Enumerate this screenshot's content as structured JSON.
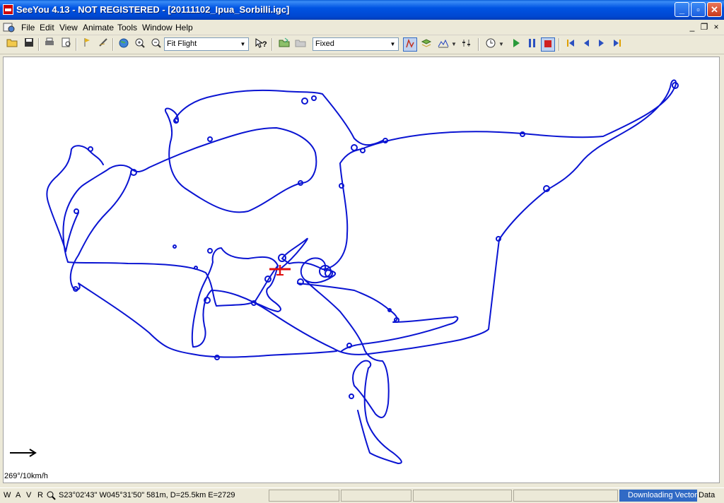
{
  "window": {
    "title": "SeeYou 4.13 - NOT REGISTERED - [20111102_Ipua_Sorbilli.igc]",
    "minimize": "_",
    "maximize": "▫",
    "close": "✕"
  },
  "menu": {
    "items": [
      "File",
      "Edit",
      "View",
      "Animate",
      "Tools",
      "Window",
      "Help"
    ],
    "mdi_minimize": "_",
    "mdi_restore": "❐",
    "mdi_close": "×"
  },
  "toolbar": {
    "zoom_mode": "Fit Flight",
    "view_mode": "Fixed"
  },
  "map": {
    "track_color": "#0a14d2",
    "glider_color": "#e01010",
    "wind_label": "269°/10km/h"
  },
  "status": {
    "letters": [
      "W",
      "A",
      "V",
      "R"
    ],
    "coords": "S23°02'43\"  W045°31'50\" 581m, D=25.5km E=2729",
    "progress_text": "Downloading Vector",
    "data_label": "Data"
  }
}
